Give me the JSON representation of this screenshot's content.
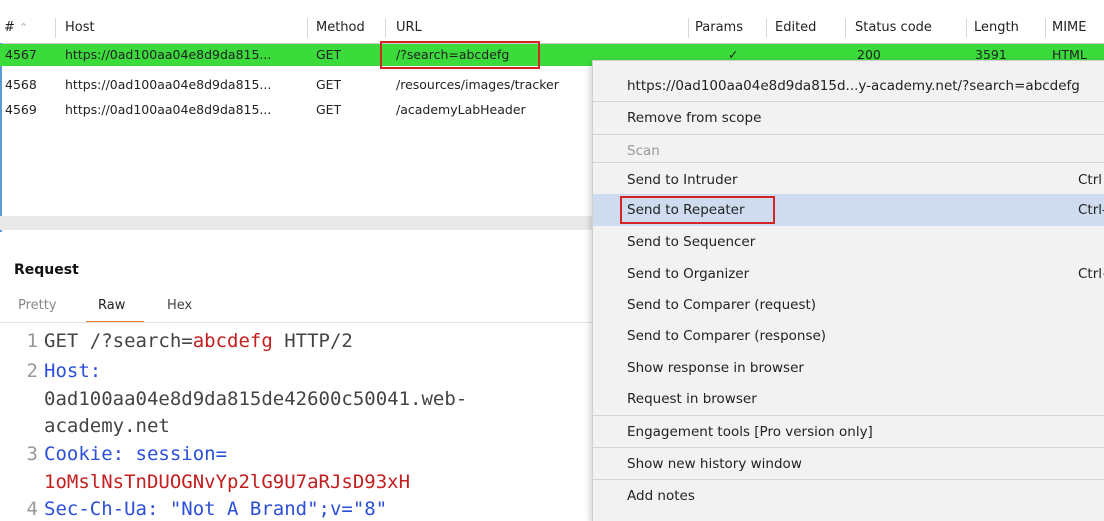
{
  "table": {
    "columns": {
      "num": "#",
      "host": "Host",
      "method": "Method",
      "url": "URL",
      "params": "Params",
      "edited": "Edited",
      "status": "Status code",
      "length": "Length",
      "mime": "MIME"
    },
    "rows": [
      {
        "num": "4567",
        "host": "https://0ad100aa04e8d9da815...",
        "method": "GET",
        "url": "/?search=abcdefg",
        "params": "✓",
        "status": "200",
        "length": "3591",
        "mime": "HTML"
      },
      {
        "num": "4568",
        "host": "https://0ad100aa04e8d9da815...",
        "method": "GET",
        "url": "/resources/images/tracker"
      },
      {
        "num": "4569",
        "host": "https://0ad100aa04e8d9da815...",
        "method": "GET",
        "url": "/academyLabHeader"
      }
    ]
  },
  "request": {
    "title": "Request",
    "tabs": [
      "Pretty",
      "Raw",
      "Hex"
    ],
    "active_tab": "Raw",
    "lines": {
      "l1_num": "1",
      "l1_method": "GET /?search=",
      "l1_val": "abcdefg",
      "l1_proto": " HTTP/2",
      "l2_num": "2",
      "l2_key": "Host:",
      "l2_val1": "0ad100aa04e8d9da815de42600c50041.web-",
      "l2_val2": "academy.net",
      "l3_num": "3",
      "l3_key": "Cookie: session=",
      "l3_val": "1oMslNsTnDUOGNvYp2lG9U7aRJsD93xH",
      "l4_num": "4",
      "l4_text": "Sec-Ch-Ua: \"Not A Brand\";v=\"8\""
    }
  },
  "menu": {
    "url": "https://0ad100aa04e8d9da815d...y-academy.net/?search=abcdefg",
    "remove_scope": "Remove from scope",
    "scan": "Scan",
    "intruder": "Send to Intruder",
    "intruder_sc": "Ctrl",
    "repeater": "Send to Repeater",
    "repeater_sc": "Ctrl-",
    "sequencer": "Send to Sequencer",
    "organizer": "Send to Organizer",
    "organizer_sc": "Ctrl+",
    "comparer_req": "Send to Comparer (request)",
    "comparer_resp": "Send to Comparer (response)",
    "show_response": "Show response in browser",
    "request_browser": "Request in browser",
    "engagement": "Engagement tools [Pro version only]",
    "history_window": "Show new history window",
    "add_notes": "Add notes"
  },
  "colors": {
    "selected_row": "#3bdb3b",
    "highlight": "#cfdcf0",
    "annotation": "#d32424",
    "tab_accent": "#e8792d"
  },
  "icons": [
    "sort-ascending-icon",
    "checkmark-icon"
  ]
}
